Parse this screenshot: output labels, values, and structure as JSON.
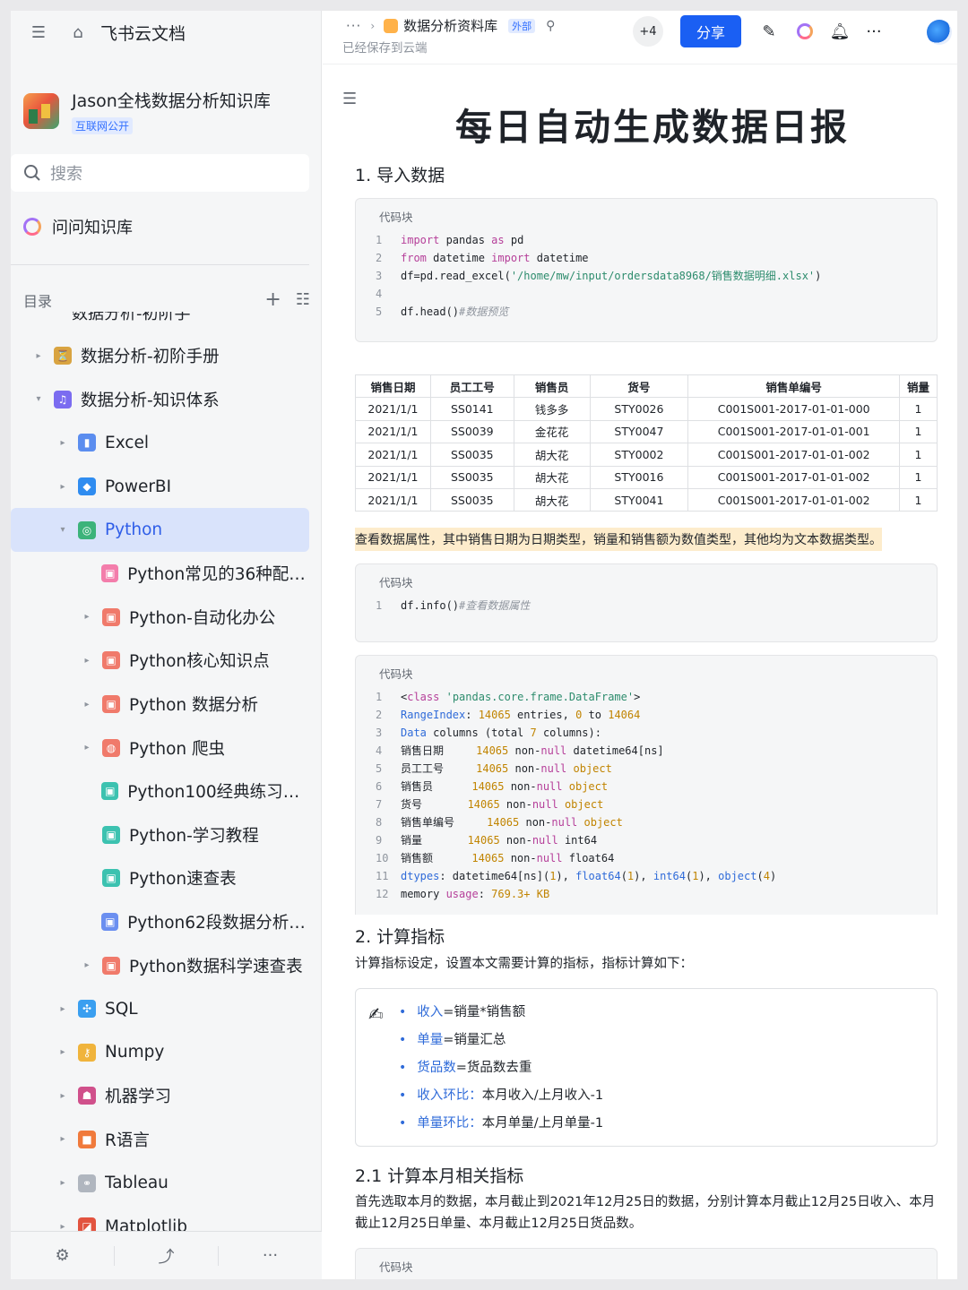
{
  "app": {
    "brand": "飞书云文档"
  },
  "kb": {
    "title": "Jason全栈数据分析知识库",
    "tag": "互联网公开"
  },
  "search": {
    "placeholder": "搜索"
  },
  "ask": {
    "label": "问问知识库"
  },
  "toc": {
    "label": "目录",
    "cut_text": "数据分析-初阶手册"
  },
  "tree": [
    {
      "label": "数据分析-初阶手册",
      "level": 0,
      "arrow": "▸",
      "icon": "hourglass-icon",
      "color": "#d9a441"
    },
    {
      "label": "数据分析-知识体系",
      "level": 0,
      "arrow": "▾",
      "icon": "music-note-icon",
      "color": "#7b6cf0"
    },
    {
      "label": "Excel",
      "level": 1,
      "arrow": "▸",
      "icon": "bar-chart-icon",
      "color": "#5b8def"
    },
    {
      "label": "PowerBI",
      "level": 1,
      "arrow": "▸",
      "icon": "diamond-icon",
      "color": "#2f8cf0"
    },
    {
      "label": "Python",
      "level": 1,
      "arrow": "▾",
      "icon": "python-icon",
      "color": "#3cb37a",
      "active": true
    },
    {
      "label": "Python常见的36种配图...",
      "level": 2,
      "arrow": "",
      "icon": "doc-icon",
      "color": "#f37dab"
    },
    {
      "label": "Python-自动化办公",
      "level": 2,
      "arrow": "▸",
      "icon": "doc-icon",
      "color": "#f07a6b"
    },
    {
      "label": "Python核心知识点",
      "level": 2,
      "arrow": "▸",
      "icon": "doc-icon",
      "color": "#f07a6b"
    },
    {
      "label": "Python 数据分析",
      "level": 2,
      "arrow": "▸",
      "icon": "doc-icon",
      "color": "#f07a6b"
    },
    {
      "label": "Python 爬虫",
      "level": 2,
      "arrow": "▸",
      "icon": "globe-icon",
      "color": "#f07a6b"
    },
    {
      "label": "Python100经典练习题....",
      "level": 2,
      "arrow": "",
      "icon": "doc-icon",
      "color": "#3cc2b0"
    },
    {
      "label": "Python-学习教程",
      "level": 2,
      "arrow": "",
      "icon": "doc-icon",
      "color": "#3cc2b0"
    },
    {
      "label": "Python速查表",
      "level": 2,
      "arrow": "",
      "icon": "doc-icon",
      "color": "#3cc2b0"
    },
    {
      "label": "Python62段数据分析和...",
      "level": 2,
      "arrow": "",
      "icon": "doc-icon",
      "color": "#6b8ff0"
    },
    {
      "label": "Python数据科学速查表",
      "level": 2,
      "arrow": "▸",
      "icon": "doc-icon",
      "color": "#f07a6b"
    },
    {
      "label": "SQL",
      "level": 1,
      "arrow": "▸",
      "icon": "sql-icon",
      "color": "#3a9ff0"
    },
    {
      "label": "Numpy",
      "level": 1,
      "arrow": "▸",
      "icon": "key-icon",
      "color": "#f0b43c"
    },
    {
      "label": "机器学习",
      "level": 1,
      "arrow": "▸",
      "icon": "robot-icon",
      "color": "#d0508b"
    },
    {
      "label": "R语言",
      "level": 1,
      "arrow": "▸",
      "icon": "r-icon",
      "color": "#f07a3c"
    },
    {
      "label": "Tableau",
      "level": 1,
      "arrow": "▸",
      "icon": "link-icon",
      "color": "#b0b6bf"
    },
    {
      "label": "Matplotlib",
      "level": 1,
      "arrow": "▸",
      "icon": "chart-icon",
      "color": "#e2533f"
    }
  ],
  "header": {
    "breadcrumb_dots": "···",
    "breadcrumb_title": "数据分析资料库",
    "external_tag": "外部",
    "saved_status": "已经保存到云端",
    "collaborators": "+4",
    "share_label": "分享"
  },
  "doc": {
    "title": "每日自动生成数据日报",
    "h_import": "1. 导入数据",
    "code_label": "代码块",
    "h_calc": "2. 计算指标",
    "calc_desc": "计算指标设定，设置本文需要计算的指标，指标计算如下：",
    "h_month": "2.1 计算本月相关指标",
    "month_desc": "首先选取本月的数据，本月截止到2021年12月25日的数据，分别计算本月截止12月25日收入、本月截止12月25日单量、本月截止12月25日货品数。",
    "highlight": "查看数据属性，其中销售日期为日期类型，销量和销售额为数值类型，其他均为文本数据类型。"
  },
  "code1": [
    [
      [
        "import ",
        "kw"
      ],
      [
        "pandas ",
        ""
      ],
      [
        "as ",
        "kw"
      ],
      [
        "pd",
        ""
      ]
    ],
    [
      [
        "from ",
        "kw"
      ],
      [
        "datetime ",
        ""
      ],
      [
        "import ",
        "kw"
      ],
      [
        "datetime",
        ""
      ]
    ],
    [
      [
        "df=pd.read_excel(",
        ""
      ],
      [
        "'/home/mw/input/ordersdata8968/销售数据明细.xlsx'",
        "str"
      ],
      [
        ")",
        ""
      ]
    ],
    [],
    [
      [
        "df.head()",
        ""
      ],
      [
        "#数据预览",
        "cm"
      ]
    ]
  ],
  "code2": [
    [
      [
        "df.info()",
        ""
      ],
      [
        "#查看数据属性",
        "cm"
      ]
    ]
  ],
  "code3": [
    [
      [
        "<",
        ""
      ],
      [
        "class ",
        "kw"
      ],
      [
        "'pandas.core.frame.DataFrame'",
        "str"
      ],
      [
        ">",
        ""
      ]
    ],
    [
      [
        "RangeIndex",
        "blue"
      ],
      [
        ": ",
        ""
      ],
      [
        "14065",
        "num"
      ],
      [
        " entries, ",
        ""
      ],
      [
        "0",
        "num"
      ],
      [
        " to ",
        ""
      ],
      [
        "14064",
        "num"
      ]
    ],
    [
      [
        "Data",
        "blue"
      ],
      [
        " columns (total ",
        ""
      ],
      [
        "7",
        "num"
      ],
      [
        " columns):",
        ""
      ]
    ],
    [
      [
        "销售日期     ",
        ""
      ],
      [
        "14065",
        "num"
      ],
      [
        " non-",
        ""
      ],
      [
        "null",
        "kw"
      ],
      [
        " datetime64[ns]",
        ""
      ]
    ],
    [
      [
        "员工工号     ",
        ""
      ],
      [
        "14065",
        "num"
      ],
      [
        " non-",
        ""
      ],
      [
        "null",
        "kw"
      ],
      [
        " object",
        "num"
      ]
    ],
    [
      [
        "销售员      ",
        ""
      ],
      [
        "14065",
        "num"
      ],
      [
        " non-",
        ""
      ],
      [
        "null",
        "kw"
      ],
      [
        " object",
        "num"
      ]
    ],
    [
      [
        "货号       ",
        ""
      ],
      [
        "14065",
        "num"
      ],
      [
        " non-",
        ""
      ],
      [
        "null",
        "kw"
      ],
      [
        " object",
        "num"
      ]
    ],
    [
      [
        "销售单编号     ",
        ""
      ],
      [
        "14065",
        "num"
      ],
      [
        " non-",
        ""
      ],
      [
        "null",
        "kw"
      ],
      [
        " object",
        "num"
      ]
    ],
    [
      [
        "销量       ",
        ""
      ],
      [
        "14065",
        "num"
      ],
      [
        " non-",
        ""
      ],
      [
        "null",
        "kw"
      ],
      [
        " int64",
        ""
      ]
    ],
    [
      [
        "销售额      ",
        ""
      ],
      [
        "14065",
        "num"
      ],
      [
        " non-",
        ""
      ],
      [
        "null",
        "kw"
      ],
      [
        " float64",
        ""
      ]
    ],
    [
      [
        "dtypes",
        "blue"
      ],
      [
        ": datetime64[ns](",
        ""
      ],
      [
        "1",
        "num"
      ],
      [
        "), ",
        ""
      ],
      [
        "float64",
        "blue"
      ],
      [
        "(",
        ""
      ],
      [
        "1",
        "num"
      ],
      [
        "), ",
        ""
      ],
      [
        "int64",
        "blue"
      ],
      [
        "(",
        ""
      ],
      [
        "1",
        "num"
      ],
      [
        "), ",
        ""
      ],
      [
        "object",
        "blue"
      ],
      [
        "(",
        ""
      ],
      [
        "4",
        "num"
      ],
      [
        ")",
        ""
      ]
    ],
    [
      [
        "memory ",
        ""
      ],
      [
        "usage",
        "kw"
      ],
      [
        ": ",
        ""
      ],
      [
        "769.3+",
        "num"
      ],
      [
        " KB",
        "num"
      ]
    ]
  ],
  "table": {
    "headers": [
      "销售日期",
      "员工工号",
      "销售员",
      "货号",
      "销售单编号",
      "销量"
    ],
    "rows": [
      [
        "2021/1/1",
        "SS0141",
        "钱多多",
        "STY0026",
        "C001S001-2017-01-01-000",
        "1"
      ],
      [
        "2021/1/1",
        "SS0039",
        "金花花",
        "STY0047",
        "C001S001-2017-01-01-001",
        "1"
      ],
      [
        "2021/1/1",
        "SS0035",
        "胡大花",
        "STY0002",
        "C001S001-2017-01-01-002",
        "1"
      ],
      [
        "2021/1/1",
        "SS0035",
        "胡大花",
        "STY0016",
        "C001S001-2017-01-01-002",
        "1"
      ],
      [
        "2021/1/1",
        "SS0035",
        "胡大花",
        "STY0041",
        "C001S001-2017-01-01-002",
        "1"
      ]
    ]
  },
  "metrics": [
    {
      "key": "收入",
      "rest": "=销量*销售额"
    },
    {
      "key": "单量",
      "rest": "=销量汇总"
    },
    {
      "key": "货品数",
      "rest": "=货品数去重"
    },
    {
      "key": "收入环比：",
      "rest": "本月收入/上月收入-1"
    },
    {
      "key": "单量环比：",
      "rest": "本月单量/上月单量-1"
    }
  ]
}
